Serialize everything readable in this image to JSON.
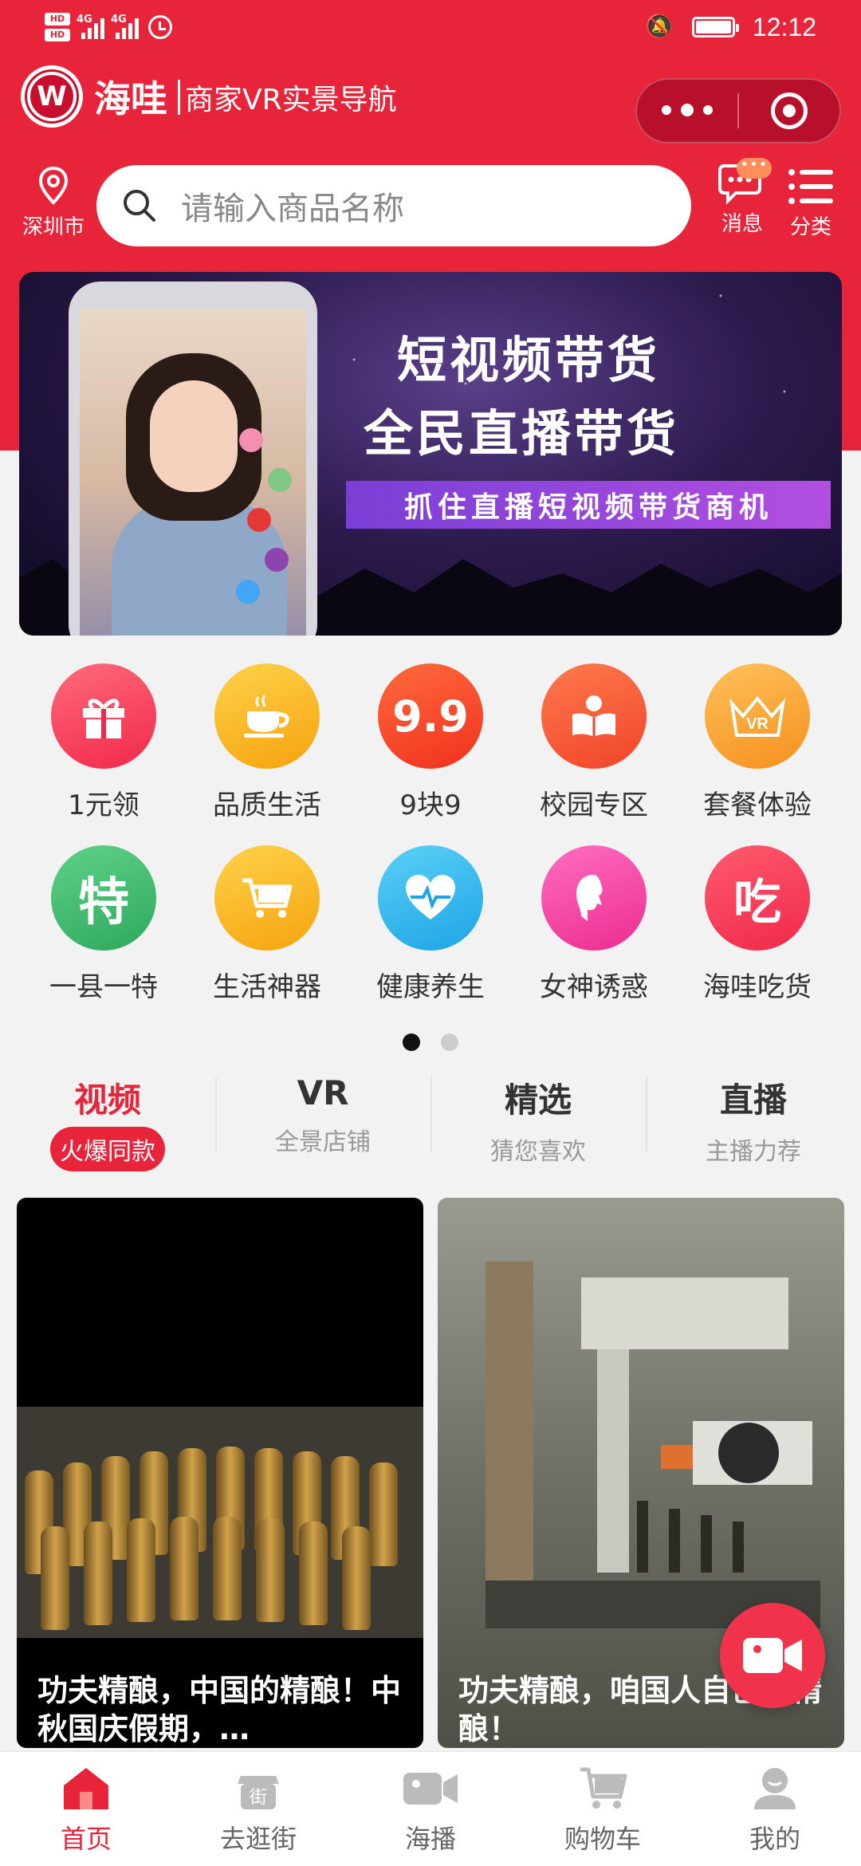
{
  "status_bar": {
    "network_left": "4G",
    "network_right": "4G",
    "time": "12:12"
  },
  "header": {
    "brand": "海哇",
    "subtitle": "商家VR实景导航",
    "logo_letter": "W"
  },
  "location": {
    "label": "深圳市"
  },
  "search": {
    "placeholder": "请输入商品名称"
  },
  "messages": {
    "label": "消息",
    "badge": "•••"
  },
  "category": {
    "label": "分类"
  },
  "banner": {
    "line1": "短视频带货",
    "line2": "全民直播带货",
    "strip": "抓住直播短视频带货商机"
  },
  "grid": [
    {
      "label": "1元领",
      "icon": "gift-icon"
    },
    {
      "label": "品质生活",
      "icon": "coffee-cup-icon"
    },
    {
      "label": "9块9",
      "icon": "nine-nine-icon",
      "glyph": "9.9"
    },
    {
      "label": "校园专区",
      "icon": "reading-icon"
    },
    {
      "label": "套餐体验",
      "icon": "vr-crown-icon",
      "glyph": "VR"
    },
    {
      "label": "一县一特",
      "icon": "special-icon",
      "glyph": "特"
    },
    {
      "label": "生活神器",
      "icon": "shopping-cart-icon"
    },
    {
      "label": "健康养生",
      "icon": "heartbeat-icon"
    },
    {
      "label": "女神诱惑",
      "icon": "woman-profile-icon"
    },
    {
      "label": "海哇吃货",
      "icon": "eat-icon",
      "glyph": "吃"
    }
  ],
  "pager": {
    "current": 1,
    "total": 2
  },
  "tabs": [
    {
      "title": "视频",
      "sub": "火爆同款",
      "active": true
    },
    {
      "title": "VR",
      "sub": "全景店铺"
    },
    {
      "title": "精选",
      "sub": "猜您喜欢"
    },
    {
      "title": "直播",
      "sub": "主播力荐"
    }
  ],
  "cards": [
    {
      "title": "功夫精酿，中国的精酿！中秋国庆假期，…"
    },
    {
      "title": "功夫精酿，咱国人自己的精酿！"
    }
  ],
  "nav": [
    {
      "label": "首页",
      "icon": "home-icon",
      "active": true
    },
    {
      "label": "去逛街",
      "icon": "street-icon"
    },
    {
      "label": "海播",
      "icon": "video-camera-icon"
    },
    {
      "label": "购物车",
      "icon": "cart-icon"
    },
    {
      "label": "我的",
      "icon": "user-icon"
    }
  ],
  "colors": {
    "brand_red": "#e8243b",
    "active_tab": "#e8243b",
    "fab": "#f0324a"
  }
}
